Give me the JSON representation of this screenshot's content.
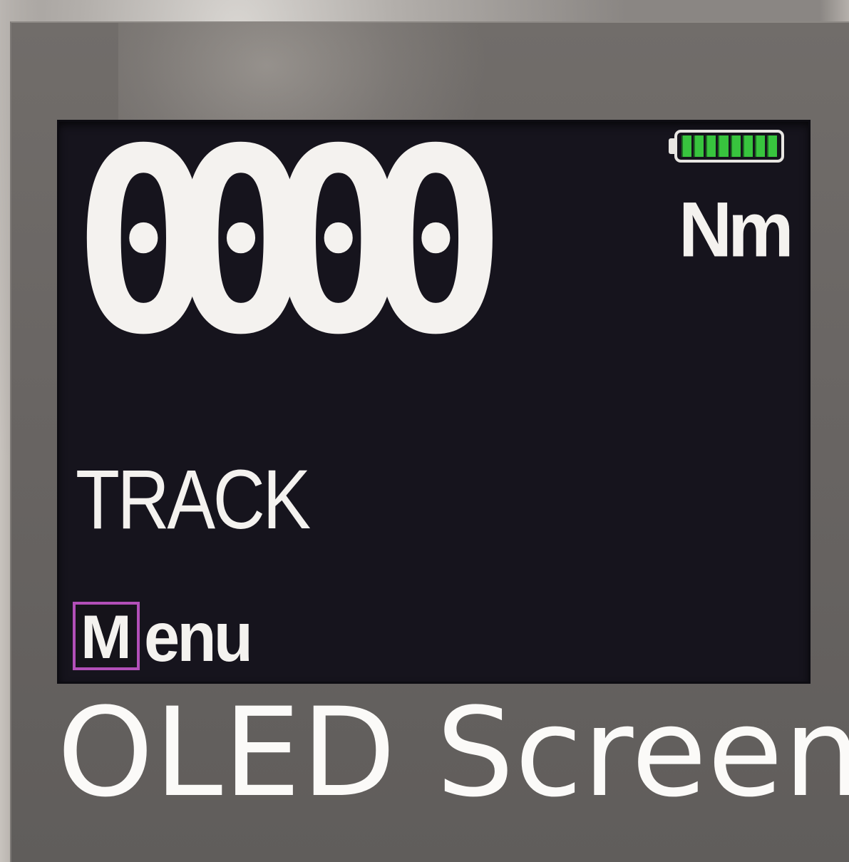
{
  "display": {
    "reading": "0000",
    "unit": "Nm",
    "mode": "TRACK",
    "battery": {
      "level": 1.0,
      "cells": 8,
      "fill_color": "#38c43e"
    },
    "menu": {
      "key_letter": "M",
      "label": "enu",
      "key_color": "#b24fb8"
    }
  },
  "caption": "OLED Screen"
}
